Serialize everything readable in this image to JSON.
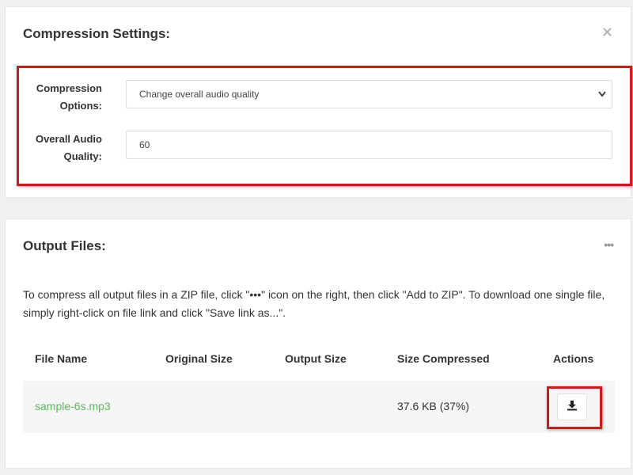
{
  "settings": {
    "title": "Compression Settings:",
    "close_icon": "close-icon",
    "compression_options": {
      "label": "Compression Options:",
      "value": "Change overall audio quality"
    },
    "audio_quality": {
      "label": "Overall Audio Quality:",
      "value": "60"
    }
  },
  "output": {
    "title": "Output Files:",
    "more_icon": "more-icon",
    "help_text": "To compress all output files in a ZIP file, click \"•••\" icon on the right, then click \"Add to ZIP\". To download one single file, simply right-click on file link and click \"Save link as...\".",
    "columns": [
      "File Name",
      "Original Size",
      "Output Size",
      "Size Compressed",
      "Actions"
    ],
    "rows": [
      {
        "file_name": "sample-6s.mp3",
        "original_size": "",
        "output_size": "",
        "size_compressed": "37.6 KB (37%)",
        "action_icon": "download-icon"
      }
    ]
  },
  "colors": {
    "highlight": "#d9141b",
    "link": "#5cb85c",
    "row_bg": "#f5f5f5"
  }
}
